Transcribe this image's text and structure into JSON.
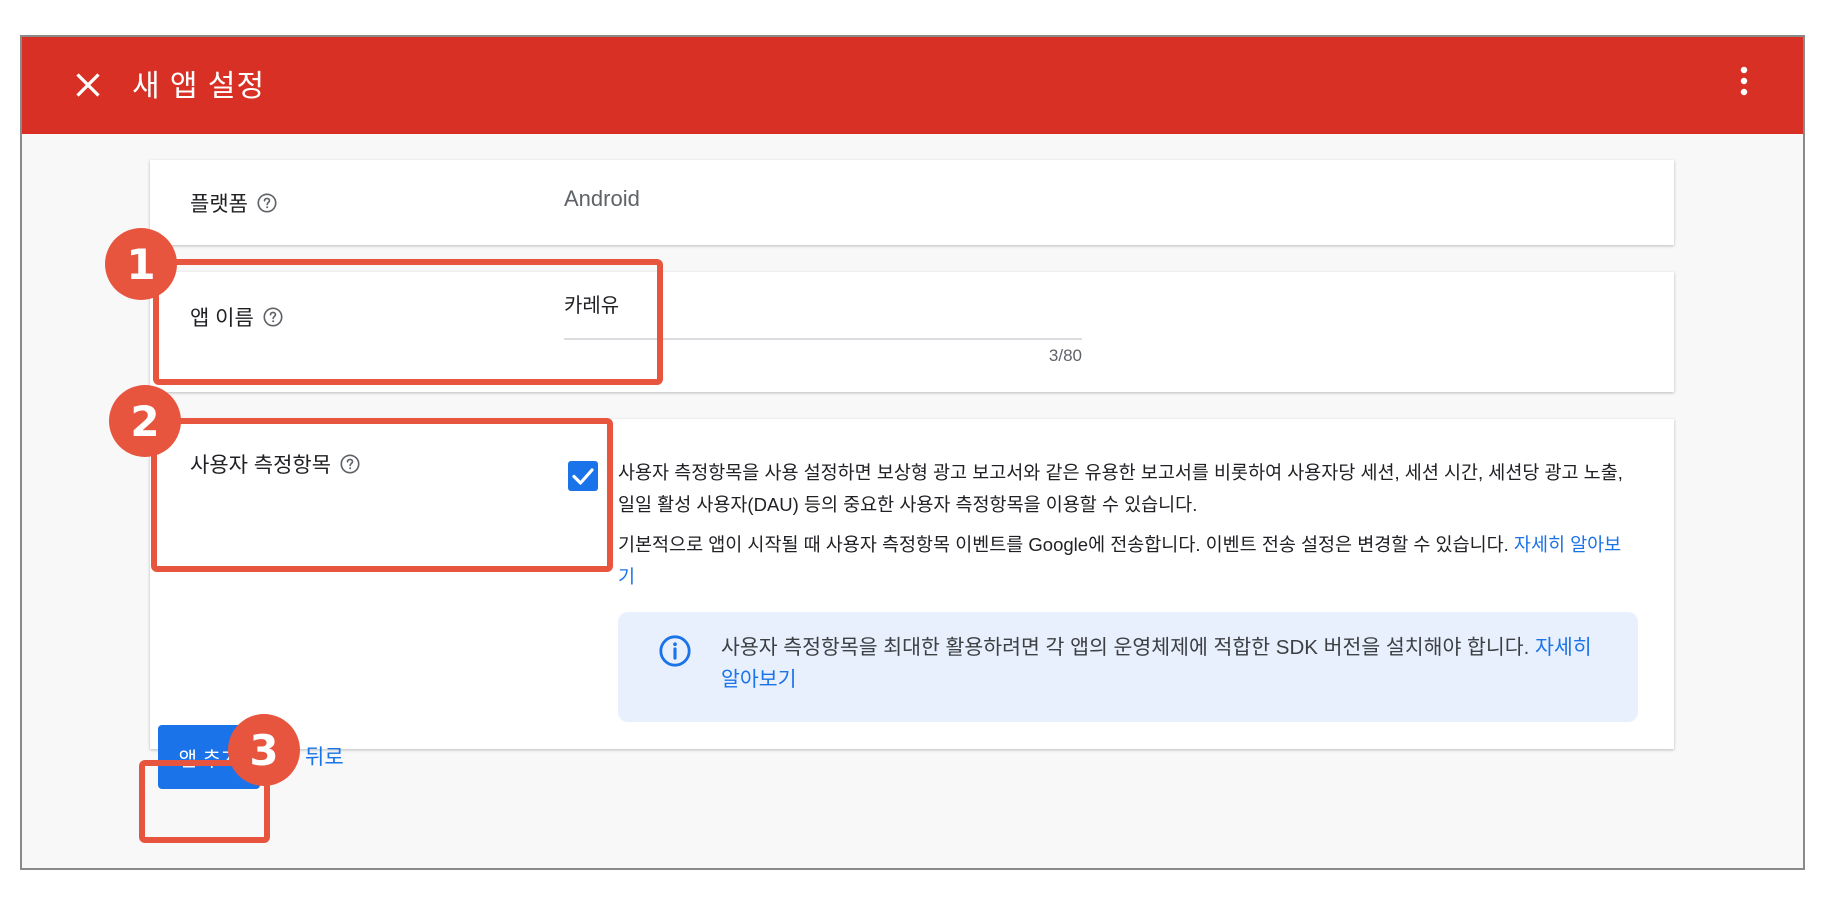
{
  "header": {
    "title": "새 앱 설정",
    "close_icon": "close-icon",
    "more_icon": "more-vert-icon",
    "background_color": "#d93025"
  },
  "platform_row": {
    "label": "플랫폼",
    "value": "Android"
  },
  "app_name_row": {
    "label": "앱 이름",
    "value": "카레유",
    "counter": "3/80"
  },
  "user_metrics_row": {
    "label": "사용자 측정항목",
    "checked": true,
    "description_1": "사용자 측정항목을 사용 설정하면 보상형 광고 보고서와 같은 유용한 보고서를 비롯하여 사용자당 세션, 세션 시간, 세션당 광고 노출, 일일 활성 사용자(DAU) 등의 중요한 사용자 측정항목을 이용할 수 있습니다.",
    "description_2": "기본적으로 앱이 시작될 때 사용자 측정항목 이벤트를 Google에 전송합니다. 이벤트 전송 설정은 변경할 수 있습니다. ",
    "learn_more": "자세히 알아보기",
    "info_text": "사용자 측정항목을 최대한 활용하려면 각 앱의 운영체제에 적합한 SDK 버전을 설치해야 합니다. ",
    "info_learn_more": "자세히 알아보기"
  },
  "actions": {
    "add_app": "앱 추가",
    "back": "뒤로"
  },
  "annotations": {
    "badge_1": "1",
    "badge_2": "2",
    "badge_3": "3",
    "color": "#e8553f"
  }
}
